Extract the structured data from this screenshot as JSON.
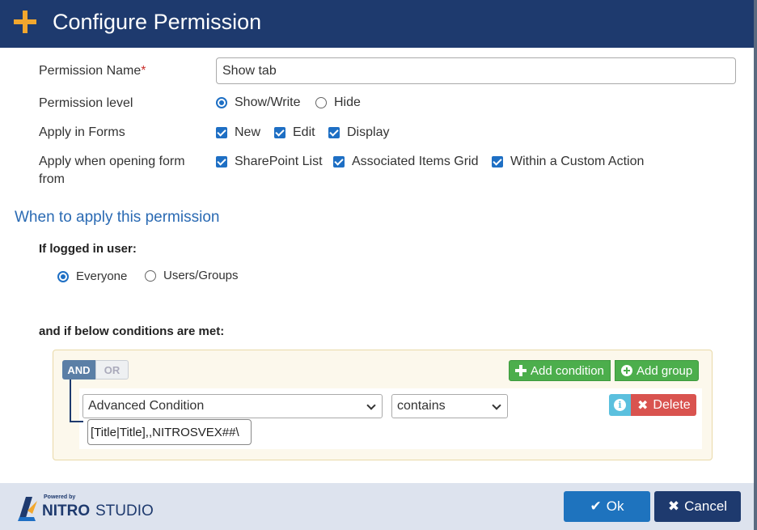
{
  "dialog": {
    "title": "Configure Permission",
    "icon": "plus-icon"
  },
  "form": {
    "permission_name": {
      "label": "Permission Name",
      "required_mark": "*",
      "value": "Show tab"
    },
    "permission_level": {
      "label": "Permission level",
      "options": [
        {
          "label": "Show/Write",
          "selected": true
        },
        {
          "label": "Hide",
          "selected": false
        }
      ]
    },
    "apply_in_forms": {
      "label": "Apply in Forms",
      "options": [
        {
          "label": "New",
          "checked": true
        },
        {
          "label": "Edit",
          "checked": true
        },
        {
          "label": "Display",
          "checked": true
        }
      ]
    },
    "apply_when_opening": {
      "label_line1": "Apply when opening form",
      "label_line2": "from",
      "options": [
        {
          "label": "SharePoint List",
          "checked": true
        },
        {
          "label": "Associated Items Grid",
          "checked": true
        },
        {
          "label": "Within a Custom Action",
          "checked": true
        }
      ]
    }
  },
  "section": {
    "title": "When to apply this permission",
    "user_label": "If logged in user:",
    "user_options": [
      {
        "label": "Everyone",
        "selected": true
      },
      {
        "label": "Users/Groups",
        "selected": false
      }
    ],
    "conditions_label": "and if below conditions are met:"
  },
  "conditions": {
    "logic": {
      "and_label": "AND",
      "or_label": "OR",
      "active": "AND"
    },
    "add_condition_label": "Add condition",
    "add_group_label": "Add group",
    "rule": {
      "field": "Advanced Condition",
      "operator": "contains",
      "value": "[Title|Title],,NITROSVEX##\\",
      "delete_label": "Delete",
      "info_icon": "info-icon"
    }
  },
  "footer": {
    "logo_powered": "Powered by",
    "logo_nitro": "NITRO",
    "logo_studio": "STUDIO",
    "ok_label": "Ok",
    "cancel_label": "Cancel"
  },
  "colors": {
    "title_bar": "#1e3a6e",
    "accent": "#f2a72e",
    "primary": "#1e73be",
    "success": "#4cae4c",
    "danger": "#d9534f",
    "info": "#5bc0de"
  }
}
